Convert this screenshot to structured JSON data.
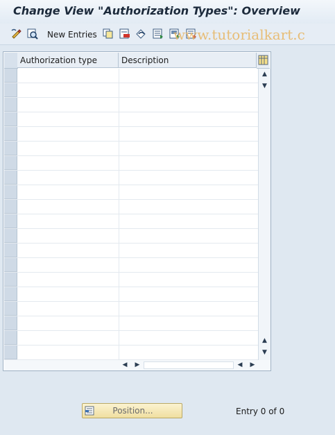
{
  "window": {
    "title": "Change View \"Authorization Types\": Overview"
  },
  "toolbar": {
    "new_entries_label": "New Entries",
    "icons": [
      "display-change-icon",
      "details-icon",
      "copy-as-icon",
      "delete-icon",
      "undo-change-icon",
      "select-all-icon",
      "select-block-icon",
      "deselect-all-icon"
    ]
  },
  "watermark": {
    "text": "www.tutorialkart.c"
  },
  "table": {
    "columns": [
      "Authorization type",
      "Description"
    ],
    "row_count": 20,
    "rows": []
  },
  "footer": {
    "position_label": "Position...",
    "entry_text": "Entry 0 of 0"
  },
  "colors": {
    "background": "#dfe8f1",
    "accent": "#e8b86a",
    "button": "#f0dfa0"
  }
}
